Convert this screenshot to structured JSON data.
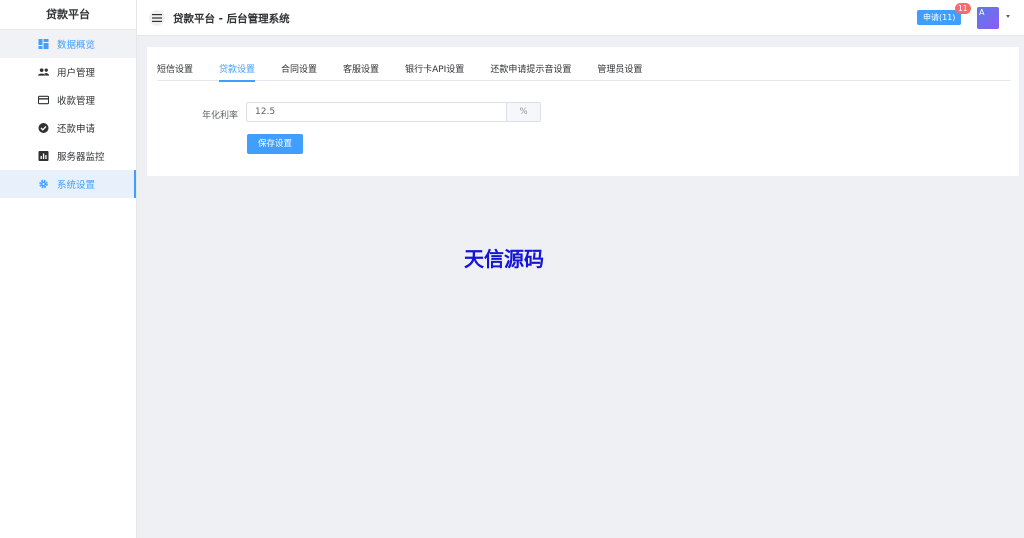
{
  "sidebar": {
    "brand": "贷款平台",
    "items": [
      {
        "label": "数据概览",
        "icon": "dashboard-icon"
      },
      {
        "label": "用户管理",
        "icon": "users-icon"
      },
      {
        "label": "收款管理",
        "icon": "credit-card-icon"
      },
      {
        "label": "还款申请",
        "icon": "check-circle-icon"
      },
      {
        "label": "服务器监控",
        "icon": "bar-chart-icon"
      },
      {
        "label": "系统设置",
        "icon": "gear-icon"
      }
    ]
  },
  "header": {
    "title": "贷款平台 - 后台管理系统",
    "apply_label": "申请(11)",
    "badge_count": "11",
    "avatar_letter": "A"
  },
  "tabs": [
    {
      "label": "短信设置"
    },
    {
      "label": "贷款设置"
    },
    {
      "label": "合同设置"
    },
    {
      "label": "客服设置"
    },
    {
      "label": "银行卡API设置"
    },
    {
      "label": "还款申请提示音设置"
    },
    {
      "label": "管理员设置"
    }
  ],
  "form": {
    "rate_label": "年化利率",
    "rate_value": "12.5",
    "rate_unit": "%",
    "save_label": "保存设置"
  },
  "watermark": "天信源码",
  "colors": {
    "accent": "#409eff",
    "badge": "#f56c6c",
    "watermark": "#1515d6"
  }
}
